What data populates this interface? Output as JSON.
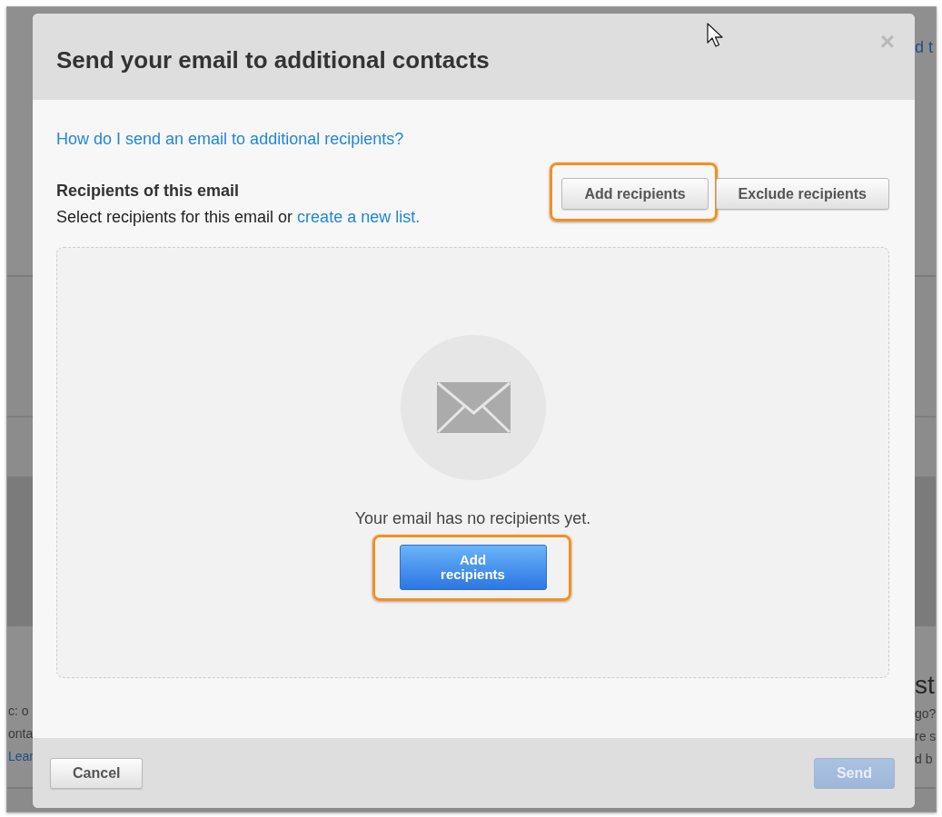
{
  "backdrop": {
    "top_right_link": "d t",
    "left_lines": [
      "c: o",
      "onta"
    ],
    "left_link": "Lear",
    "right_heading": "st",
    "right_lines": [
      "go?",
      "re s",
      "d b"
    ]
  },
  "dialog": {
    "title": "Send your email to additional contacts",
    "close": "×",
    "help_link": "How do I send an email to additional recipients?",
    "recipients": {
      "heading": "Recipients of this email",
      "text": "Select recipients for this email or",
      "link": "create a new list."
    },
    "actions": [
      {
        "label": "Add recipients",
        "highlighted": true
      },
      {
        "label": "Exclude recipients",
        "highlighted": false
      }
    ],
    "empty_state": {
      "message": "Your email has no recipients yet.",
      "button": {
        "label": "Add recipients",
        "highlighted": true
      }
    },
    "footer": {
      "buttons": [
        {
          "label": "Cancel",
          "kind": "secondary",
          "disabled": false
        },
        {
          "label": "Send",
          "kind": "primary",
          "disabled": true
        }
      ]
    }
  }
}
